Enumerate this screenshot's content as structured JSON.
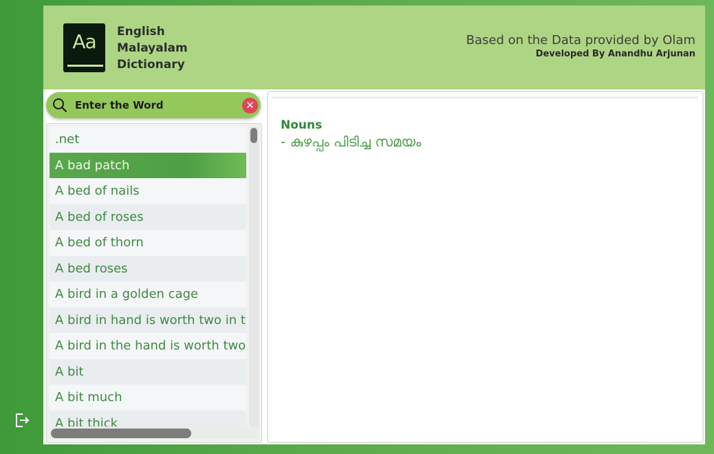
{
  "header": {
    "logo_text": "Aa",
    "title_lines": [
      "English",
      "Malayalam",
      "Dictionary"
    ],
    "based_on": "Based on the Data provided by Olam",
    "developer": "Developed By Anandhu Arjunan"
  },
  "search": {
    "placeholder": "Enter the Word",
    "value": "",
    "clear_symbol": "✕",
    "icon": "search-icon"
  },
  "word_list": {
    "items": [
      ".net",
      "A bad patch",
      "A bed of nails",
      "A bed of roses",
      "A bed of thorn",
      "A bed roses",
      "A bird in a golden cage",
      "A bird in hand is worth  two in the bush",
      "A bird in the hand is worth two in the bush",
      "A bit",
      "A bit much",
      "A bit thick"
    ],
    "selected_index": 1
  },
  "definition": {
    "part_of_speech": "Nouns",
    "meaning": "- കുഴപ്പം പിടിച്ച സമയം"
  },
  "colors": {
    "background": "#4fa243",
    "header": "#aed584",
    "accent": "#3f8a40",
    "search_bar": "#94c85a",
    "clear_button": "#e04556",
    "logo_bg": "#0b1a0e"
  },
  "icons": {
    "logout": "logout-icon"
  }
}
